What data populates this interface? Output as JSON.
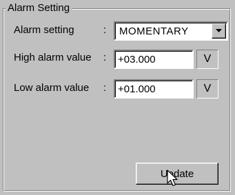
{
  "group": {
    "title": "Alarm Setting"
  },
  "rows": {
    "alarm_setting": {
      "label": "Alarm setting",
      "colon": ":",
      "value": "MOMENTARY"
    },
    "high_alarm": {
      "label": "High alarm value",
      "colon": ":",
      "value": "+03.000",
      "unit": "V"
    },
    "low_alarm": {
      "label": "Low alarm value",
      "colon": ":",
      "value": "+01.000",
      "unit": "V"
    }
  },
  "buttons": {
    "update": "Update"
  },
  "icons": {
    "dropdown": "chevron-down-icon",
    "cursor": "mouse-pointer-icon"
  }
}
